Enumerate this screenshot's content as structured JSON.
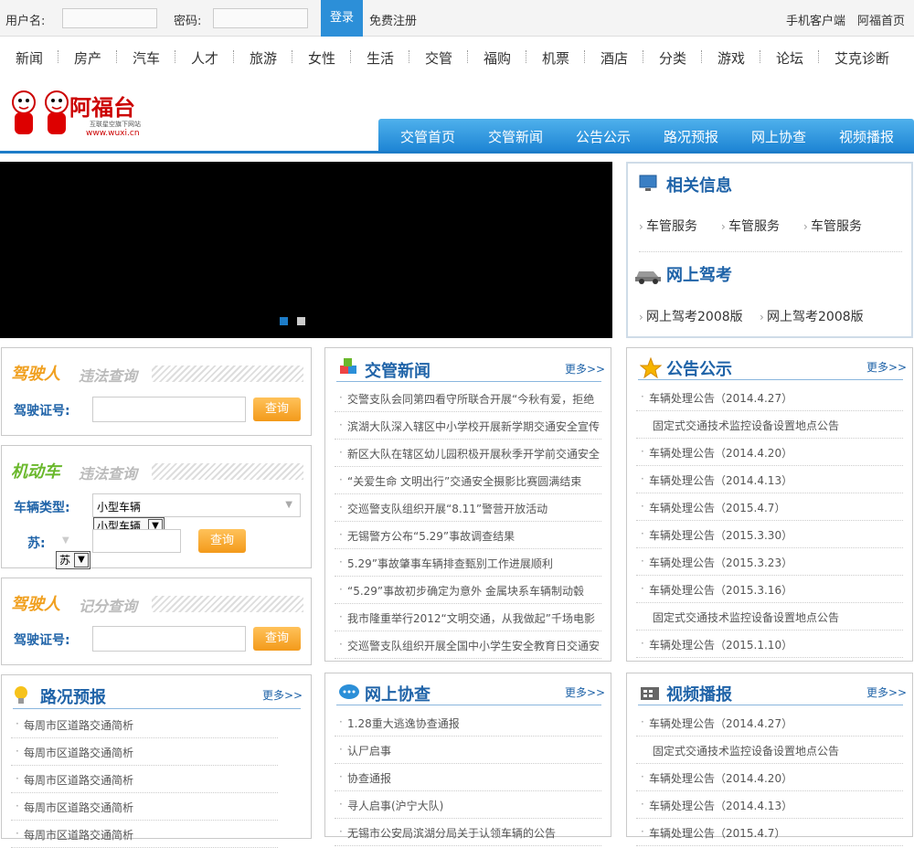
{
  "topbar": {
    "username_label": "用户名:",
    "password_label": "密码:",
    "login": "登录",
    "register": "免费注册",
    "mobile": "手机客户端",
    "home": "阿福首页"
  },
  "nav": [
    "新闻",
    "房产",
    "汽车",
    "人才",
    "旅游",
    "女性",
    "生活",
    "交管",
    "福购",
    "机票",
    "酒店",
    "分类",
    "游戏",
    "论坛",
    "艾克诊断"
  ],
  "logo": {
    "text": "阿福台",
    "sub": "互联星空旗下网站",
    "url": "www.wuxi.cn"
  },
  "subnav": [
    "交管首页",
    "交管新闻",
    "公告公示",
    "路况预报",
    "网上协查",
    "视频播报"
  ],
  "related": {
    "title": "相关信息",
    "items": [
      "车管服务",
      "车管服务",
      "车管服务"
    ],
    "exam_title": "网上驾考",
    "exam_items": [
      "网上驾考2008版",
      "网上驾考2008版"
    ]
  },
  "query1": {
    "title1": "驾驶人",
    "title2": "违法查询",
    "label": "驾驶证号:",
    "button": "查询"
  },
  "query2": {
    "title1": "机动车",
    "title2": "违法查询",
    "type_label": "车辆类型:",
    "type_value": "小型车辆",
    "type_select": "小型车辆",
    "plate_label": "苏:",
    "plate_select": "苏",
    "button": "查询"
  },
  "query3": {
    "title1": "驾驶人",
    "title2": "记分查询",
    "label": "驾驶证号:",
    "button": "查询"
  },
  "news": {
    "title": "交管新闻",
    "more": "更多>>",
    "items": [
      "交警支队会同第四看守所联合开展“今秋有爱，拒绝",
      "滨湖大队深入辖区中小学校开展新学期交通安全宣传",
      "新区大队在辖区幼儿园积极开展秋季开学前交通安全",
      "“关爱生命 文明出行”交通安全摄影比赛圆满结束",
      "交巡警支队组织开展“8.11”警营开放活动",
      "无锡警方公布“5.29”事故调查结果",
      "5.29”事故肇事车辆排查甄别工作进展顺利",
      "“5.29”事故初步确定为意外 金属块系车辆制动毂",
      "我市隆重举行2012“文明交通，从我做起”千场电影",
      "交巡警支队组织开展全国中小学生安全教育日交通安"
    ]
  },
  "notice": {
    "title": "公告公示",
    "more": "更多>>",
    "items": [
      "车辆处理公告（2014.4.27）",
      "固定式交通技术监控设备设置地点公告",
      "车辆处理公告（2014.4.20）",
      "车辆处理公告（2014.4.13）",
      "车辆处理公告（2015.4.7）",
      "车辆处理公告（2015.3.30）",
      "车辆处理公告（2015.3.23）",
      "车辆处理公告（2015.3.16）",
      "固定式交通技术监控设备设置地点公告",
      "车辆处理公告（2015.1.10）"
    ],
    "bullets": [
      true,
      false,
      true,
      true,
      true,
      true,
      true,
      true,
      false,
      true
    ]
  },
  "road": {
    "title": "路况预报",
    "more": "更多>>",
    "items": [
      "每周市区道路交通简析",
      "每周市区道路交通简析",
      "每周市区道路交通简析",
      "每周市区道路交通简析",
      "每周市区道路交通简析"
    ]
  },
  "assist": {
    "title": "网上协查",
    "more": "更多>>",
    "items": [
      "1.28重大逃逸协查通报",
      "认尸启事",
      "协查通报",
      "寻人启事(沪宁大队)",
      "无锡市公安局滨湖分局关于认领车辆的公告"
    ]
  },
  "video": {
    "title": "视频播报",
    "more": "更多>>",
    "items": [
      "车辆处理公告（2014.4.27）",
      "固定式交通技术监控设备设置地点公告",
      "车辆处理公告（2014.4.20）",
      "车辆处理公告（2014.4.13）",
      "车辆处理公告（2015.4.7）"
    ],
    "bullets": [
      true,
      false,
      true,
      true,
      true
    ]
  },
  "colors": {
    "accent": "#1d7cc8",
    "button": "#f39a1a",
    "title": "#1f63a8"
  }
}
